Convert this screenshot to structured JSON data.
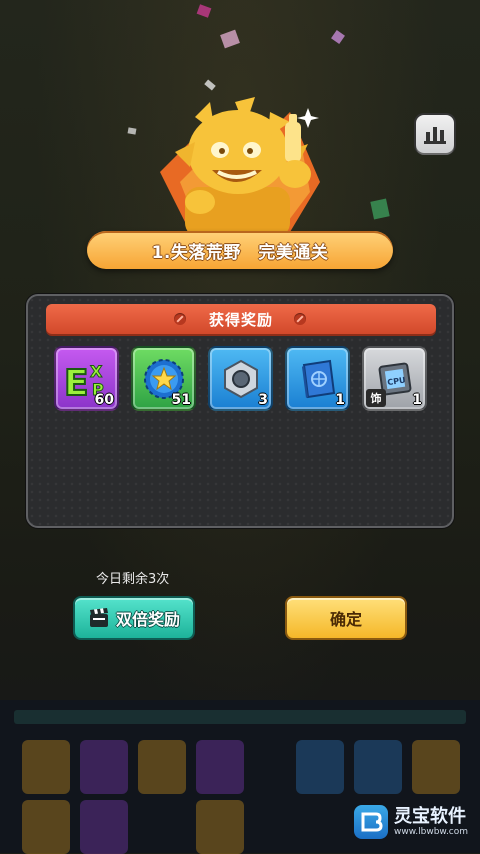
{
  "stage": {
    "title": "1.失落荒野　完美通关"
  },
  "icons": {
    "stats": "bar-chart-icon",
    "double": "film-clapper-icon"
  },
  "rewards_panel": {
    "header": "获得奖励",
    "items": [
      {
        "icon": "exp-icon",
        "count": "60",
        "color": "#a84be0"
      },
      {
        "icon": "bottle-cap-icon",
        "count": "51",
        "color": "#3dbb4f"
      },
      {
        "icon": "hex-nut-icon",
        "count": "3",
        "color": "#2f97e6"
      },
      {
        "icon": "blueprint-book-icon",
        "count": "1",
        "color": "#2f97e6"
      },
      {
        "icon": "cpu-chip-icon",
        "count": "1",
        "tag": "饰",
        "color": "#b9bcc1"
      }
    ]
  },
  "remaining_text": "今日剩余3次",
  "buttons": {
    "double": "双倍奖励",
    "confirm": "确定"
  },
  "watermark": {
    "name": "灵宝软件",
    "url": "www.lbwbw.com"
  }
}
